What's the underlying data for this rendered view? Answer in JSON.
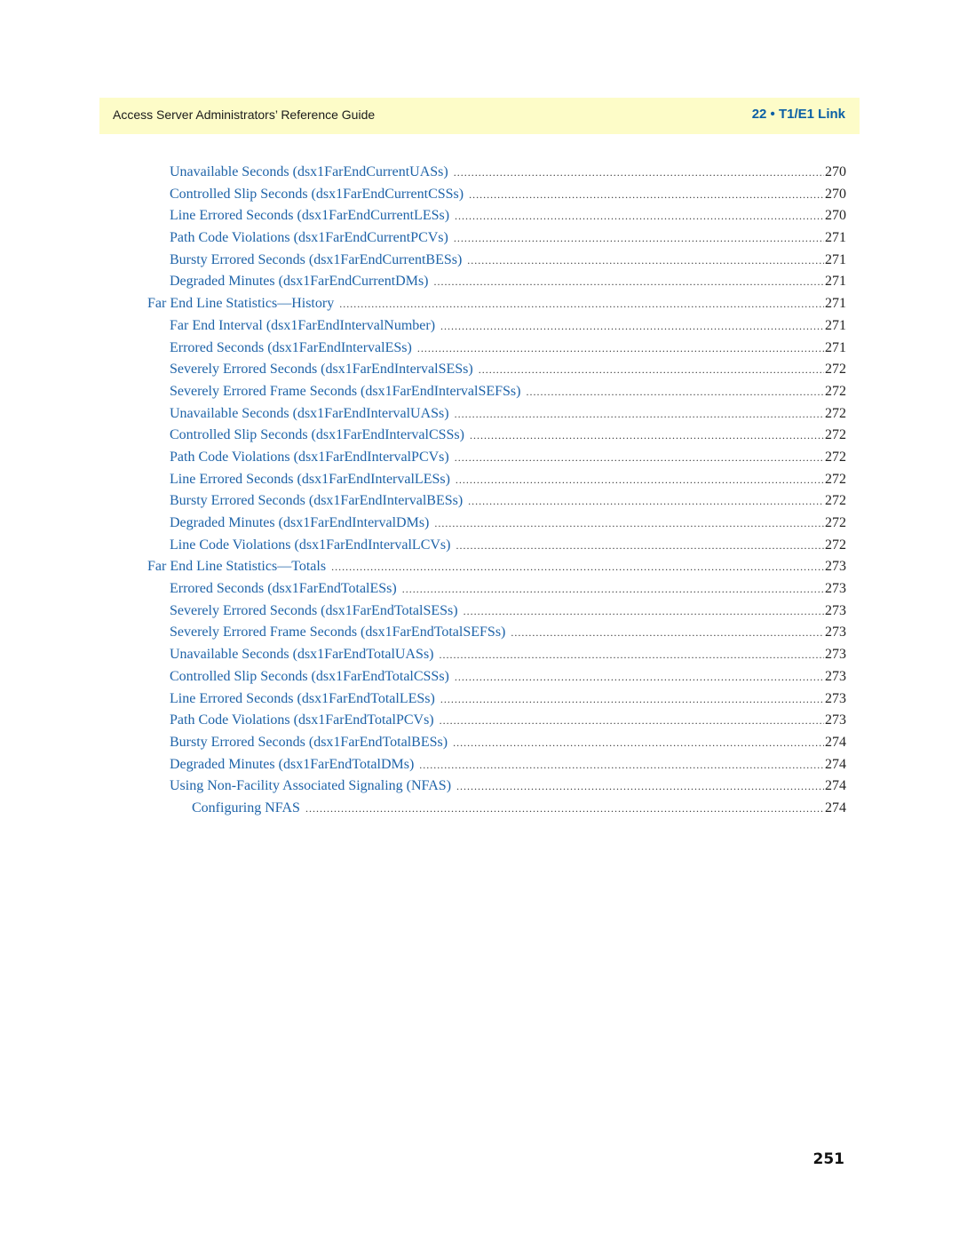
{
  "header": {
    "guide_title": "Access Server Administrators’ Reference Guide",
    "chapter": "22 • T1/E1 Link",
    "accent_color": "#0b5fa5",
    "band_color": "#fdfcc8"
  },
  "toc": [
    {
      "level": 2,
      "title": "Unavailable Seconds (dsx1FarEndCurrentUASs)",
      "page": "270"
    },
    {
      "level": 2,
      "title": "Controlled Slip Seconds (dsx1FarEndCurrentCSSs)",
      "page": "270"
    },
    {
      "level": 2,
      "title": "Line Errored Seconds (dsx1FarEndCurrentLESs)",
      "page": "270"
    },
    {
      "level": 2,
      "title": "Path Code Violations (dsx1FarEndCurrentPCVs)",
      "page": "271"
    },
    {
      "level": 2,
      "title": "Bursty Errored Seconds (dsx1FarEndCurrentBESs)",
      "page": "271"
    },
    {
      "level": 2,
      "title": "Degraded Minutes (dsx1FarEndCurrentDMs)",
      "page": "271"
    },
    {
      "level": 1,
      "title": "Far End Line Statistics—History",
      "page": "271"
    },
    {
      "level": 2,
      "title": "Far End Interval (dsx1FarEndIntervalNumber)",
      "page": "271"
    },
    {
      "level": 2,
      "title": "Errored Seconds (dsx1FarEndIntervalESs)",
      "page": "271"
    },
    {
      "level": 2,
      "title": "Severely Errored Seconds (dsx1FarEndIntervalSESs)",
      "page": "272"
    },
    {
      "level": 2,
      "title": "Severely Errored Frame Seconds (dsx1FarEndIntervalSEFSs)",
      "page": "272"
    },
    {
      "level": 2,
      "title": "Unavailable Seconds (dsx1FarEndIntervalUASs)",
      "page": "272"
    },
    {
      "level": 2,
      "title": "Controlled Slip Seconds (dsx1FarEndIntervalCSSs)",
      "page": "272"
    },
    {
      "level": 2,
      "title": "Path Code Violations (dsx1FarEndIntervalPCVs)",
      "page": "272"
    },
    {
      "level": 2,
      "title": "Line Errored Seconds (dsx1FarEndIntervalLESs)",
      "page": "272"
    },
    {
      "level": 2,
      "title": "Bursty Errored Seconds (dsx1FarEndIntervalBESs)",
      "page": "272"
    },
    {
      "level": 2,
      "title": "Degraded Minutes (dsx1FarEndIntervalDMs)",
      "page": "272"
    },
    {
      "level": 2,
      "title": "Line Code Violations (dsx1FarEndIntervalLCVs)",
      "page": "272"
    },
    {
      "level": 1,
      "title": "Far End Line Statistics—Totals",
      "page": "273"
    },
    {
      "level": 2,
      "title": "Errored Seconds (dsx1FarEndTotalESs)",
      "page": "273"
    },
    {
      "level": 2,
      "title": "Severely Errored Seconds (dsx1FarEndTotalSESs)",
      "page": "273"
    },
    {
      "level": 2,
      "title": "Severely Errored Frame Seconds (dsx1FarEndTotalSEFSs)",
      "page": "273"
    },
    {
      "level": 2,
      "title": "Unavailable Seconds (dsx1FarEndTotalUASs)",
      "page": "273"
    },
    {
      "level": 2,
      "title": "Controlled Slip Seconds (dsx1FarEndTotalCSSs)",
      "page": "273"
    },
    {
      "level": 2,
      "title": "Line Errored Seconds (dsx1FarEndTotalLESs)",
      "page": "273"
    },
    {
      "level": 2,
      "title": "Path Code Violations (dsx1FarEndTotalPCVs)",
      "page": "273"
    },
    {
      "level": 2,
      "title": "Bursty Errored Seconds (dsx1FarEndTotalBESs)",
      "page": "274"
    },
    {
      "level": 2,
      "title": "Degraded Minutes (dsx1FarEndTotalDMs)",
      "page": "274"
    },
    {
      "level": 2,
      "title": "Using Non-Facility Associated Signaling (NFAS)",
      "page": "274"
    },
    {
      "level": 3,
      "title": "Configuring NFAS",
      "page": "274"
    }
  ],
  "footer": {
    "page_number": "251"
  }
}
